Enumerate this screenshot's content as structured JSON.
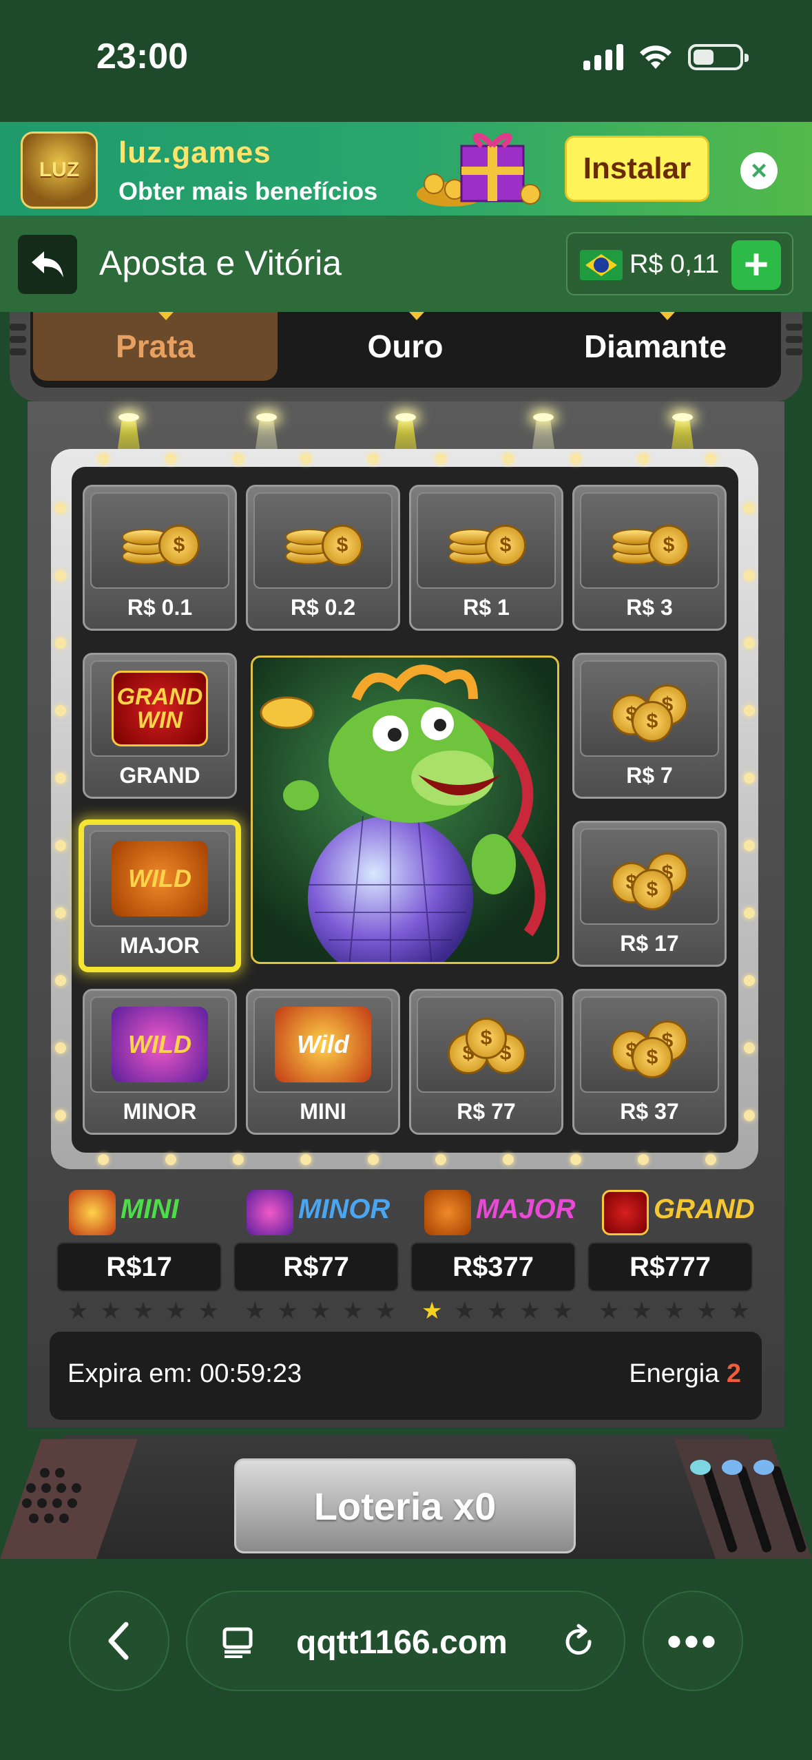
{
  "status": {
    "time": "23:00"
  },
  "banner": {
    "title": "luz.games",
    "subtitle": "Obter mais benefícios",
    "install_label": "Instalar",
    "close_icon": "close-icon",
    "logo_text": "LUZ"
  },
  "header": {
    "title": "Aposta e Vitória",
    "balance": "R$ 0,11",
    "back_icon": "back-arrow-icon",
    "flag_icon": "brazil-flag-icon",
    "add_icon": "plus-icon"
  },
  "tabs": [
    {
      "label": "Prata",
      "active": true
    },
    {
      "label": "Ouro",
      "active": false
    },
    {
      "label": "Diamante",
      "active": false
    }
  ],
  "grid": {
    "cells": [
      {
        "label": "R$ 0.1",
        "icon": "coin-stack-icon"
      },
      {
        "label": "R$ 0.2",
        "icon": "coin-stack-icon"
      },
      {
        "label": "R$ 1",
        "icon": "coin-stack-icon"
      },
      {
        "label": "R$ 3",
        "icon": "coin-stack-icon"
      },
      {
        "label": "GRAND",
        "icon": "grand-win-icon",
        "badge": "GRAND WIN"
      },
      {
        "label": "R$ 7",
        "icon": "coin-pile-icon"
      },
      {
        "label": "MAJOR",
        "icon": "tiger-wild-icon",
        "badge": "WILD",
        "selected": true
      },
      {
        "label": "R$ 17",
        "icon": "coin-pile-icon"
      },
      {
        "label": "MINOR",
        "icon": "rabbit-wild-icon",
        "badge": "WILD"
      },
      {
        "label": "MINI",
        "icon": "dragon-wild-icon",
        "badge": "Wild"
      },
      {
        "label": "R$ 77",
        "icon": "coin-pile-icon"
      },
      {
        "label": "R$ 37",
        "icon": "coin-pile-icon"
      }
    ],
    "center_art": "dragon-disco-ball-icon"
  },
  "jackpots": [
    {
      "name": "MINI",
      "value": "R$17",
      "color": "#4fdc4a",
      "stars_on": 0
    },
    {
      "name": "MINOR",
      "value": "R$77",
      "color": "#4aa6f0",
      "stars_on": 0
    },
    {
      "name": "MAJOR",
      "value": "R$377",
      "color": "#e84ad6",
      "stars_on": 1
    },
    {
      "name": "GRAND",
      "value": "R$777",
      "color": "#f5c832",
      "stars_on": 0
    }
  ],
  "info": {
    "expira_label": "Expira em: 00:59:23",
    "energia_label": "Energia",
    "energia_value": "2"
  },
  "lottery_button": "Loteria x0",
  "browser": {
    "url": "qqtt1166.com",
    "back_icon": "chevron-left-icon",
    "tabs_icon": "tabs-icon",
    "reload_icon": "reload-icon",
    "more_icon": "more-icon"
  }
}
